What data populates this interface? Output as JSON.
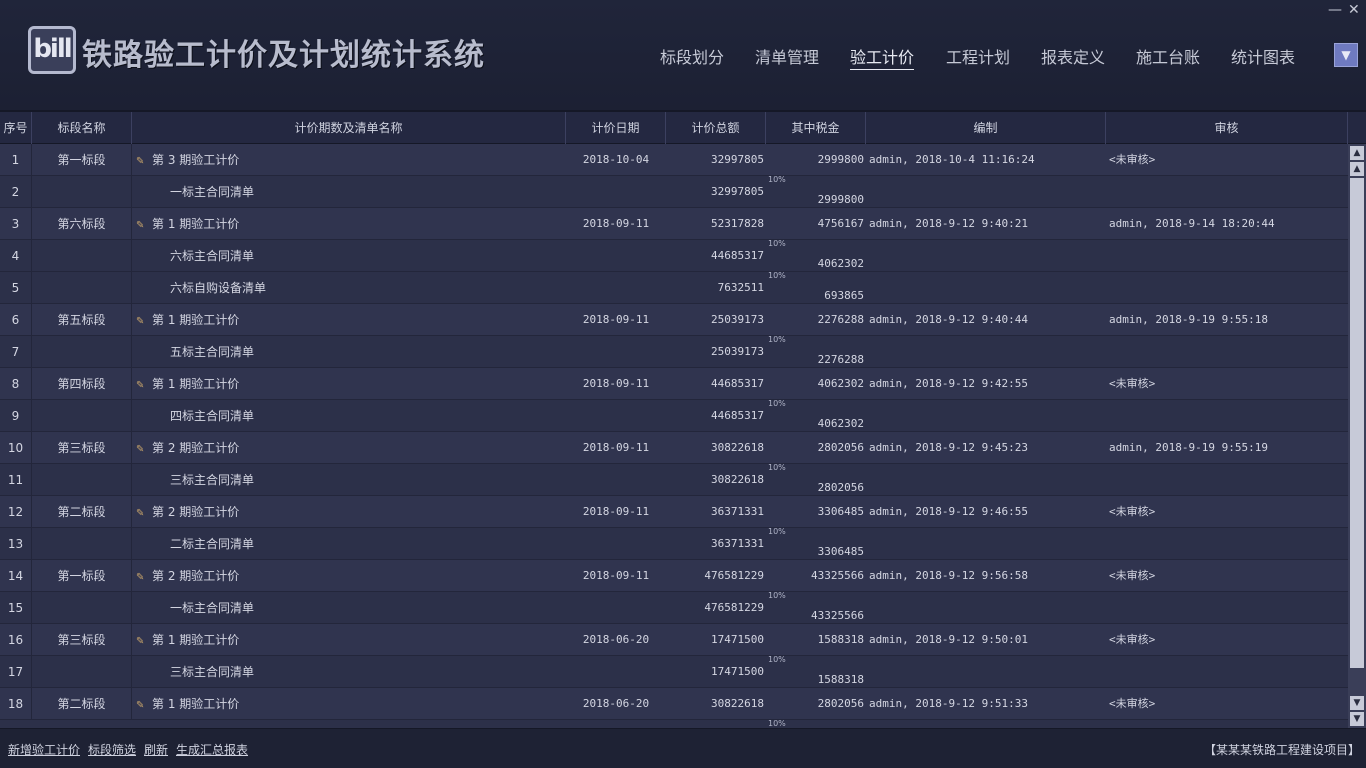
{
  "app": {
    "title": "铁路验工计价及计划统计系统",
    "logo_text": "bill",
    "minimize_label": "—",
    "close_label": "✕"
  },
  "nav": {
    "items": [
      {
        "label": "标段划分"
      },
      {
        "label": "清单管理"
      },
      {
        "label": "验工计价",
        "active": true
      },
      {
        "label": "工程计划"
      },
      {
        "label": "报表定义"
      },
      {
        "label": "施工台账"
      },
      {
        "label": "统计图表"
      }
    ],
    "dropdown_icon": "chevron-down-icon"
  },
  "grid": {
    "headers": [
      "序号",
      "标段名称",
      "计价期数及清单名称",
      "计价日期",
      "计价总额",
      "其中税金",
      "编制",
      "审核"
    ],
    "rows": [
      {
        "seq": "1",
        "section": "第一标段",
        "name": "第 3 期验工计价",
        "date": "2018-10-04",
        "total": "32997805",
        "tax": "2999800",
        "editor": "admin, 2018-10-4 11:16:24",
        "audit": "<未审核>",
        "type": "parent"
      },
      {
        "seq": "2",
        "section": "",
        "name": "一标主合同清单",
        "date": "",
        "total": "32997805",
        "pct": "10%",
        "tax": "2999800",
        "editor": "",
        "audit": "",
        "type": "child"
      },
      {
        "seq": "3",
        "section": "第六标段",
        "name": "第 1 期验工计价",
        "date": "2018-09-11",
        "total": "52317828",
        "tax": "4756167",
        "editor": "admin, 2018-9-12 9:40:21",
        "audit": "admin, 2018-9-14 18:20:44",
        "type": "parent"
      },
      {
        "seq": "4",
        "section": "",
        "name": "六标主合同清单",
        "date": "",
        "total": "44685317",
        "pct": "10%",
        "tax": "4062302",
        "editor": "",
        "audit": "",
        "type": "child"
      },
      {
        "seq": "5",
        "section": "",
        "name": "六标自购设备清单",
        "date": "",
        "total": "7632511",
        "pct": "10%",
        "tax": "693865",
        "editor": "",
        "audit": "",
        "type": "child"
      },
      {
        "seq": "6",
        "section": "第五标段",
        "name": "第 1 期验工计价",
        "date": "2018-09-11",
        "total": "25039173",
        "tax": "2276288",
        "editor": "admin, 2018-9-12 9:40:44",
        "audit": "admin, 2018-9-19 9:55:18",
        "type": "parent"
      },
      {
        "seq": "7",
        "section": "",
        "name": "五标主合同清单",
        "date": "",
        "total": "25039173",
        "pct": "10%",
        "tax": "2276288",
        "editor": "",
        "audit": "",
        "type": "child"
      },
      {
        "seq": "8",
        "section": "第四标段",
        "name": "第 1 期验工计价",
        "date": "2018-09-11",
        "total": "44685317",
        "tax": "4062302",
        "editor": "admin, 2018-9-12 9:42:55",
        "audit": "<未审核>",
        "type": "parent"
      },
      {
        "seq": "9",
        "section": "",
        "name": "四标主合同清单",
        "date": "",
        "total": "44685317",
        "pct": "10%",
        "tax": "4062302",
        "editor": "",
        "audit": "",
        "type": "child"
      },
      {
        "seq": "10",
        "section": "第三标段",
        "name": "第 2 期验工计价",
        "date": "2018-09-11",
        "total": "30822618",
        "tax": "2802056",
        "editor": "admin, 2018-9-12 9:45:23",
        "audit": "admin, 2018-9-19 9:55:19",
        "type": "parent"
      },
      {
        "seq": "11",
        "section": "",
        "name": "三标主合同清单",
        "date": "",
        "total": "30822618",
        "pct": "10%",
        "tax": "2802056",
        "editor": "",
        "audit": "",
        "type": "child"
      },
      {
        "seq": "12",
        "section": "第二标段",
        "name": "第 2 期验工计价",
        "date": "2018-09-11",
        "total": "36371331",
        "tax": "3306485",
        "editor": "admin, 2018-9-12 9:46:55",
        "audit": "<未审核>",
        "type": "parent"
      },
      {
        "seq": "13",
        "section": "",
        "name": "二标主合同清单",
        "date": "",
        "total": "36371331",
        "pct": "10%",
        "tax": "3306485",
        "editor": "",
        "audit": "",
        "type": "child"
      },
      {
        "seq": "14",
        "section": "第一标段",
        "name": "第 2 期验工计价",
        "date": "2018-09-11",
        "total": "476581229",
        "tax": "43325566",
        "editor": "admin, 2018-9-12 9:56:58",
        "audit": "<未审核>",
        "type": "parent"
      },
      {
        "seq": "15",
        "section": "",
        "name": "一标主合同清单",
        "date": "",
        "total": "476581229",
        "pct": "10%",
        "tax": "43325566",
        "editor": "",
        "audit": "",
        "type": "child"
      },
      {
        "seq": "16",
        "section": "第三标段",
        "name": "第 1 期验工计价",
        "date": "2018-06-20",
        "total": "17471500",
        "tax": "1588318",
        "editor": "admin, 2018-9-12 9:50:01",
        "audit": "<未审核>",
        "type": "parent"
      },
      {
        "seq": "17",
        "section": "",
        "name": "三标主合同清单",
        "date": "",
        "total": "17471500",
        "pct": "10%",
        "tax": "1588318",
        "editor": "",
        "audit": "",
        "type": "child"
      },
      {
        "seq": "18",
        "section": "第二标段",
        "name": "第 1 期验工计价",
        "date": "2018-06-20",
        "total": "30822618",
        "tax": "2802056",
        "editor": "admin, 2018-9-12 9:51:33",
        "audit": "<未审核>",
        "type": "parent"
      }
    ],
    "partial_row_pct": "10%",
    "scroll_up_label": "▲",
    "scroll_down_label": "▼"
  },
  "footer": {
    "actions": [
      "新增验工计价",
      "标段筛选",
      "刷新",
      "生成汇总报表"
    ],
    "project": "【某某某铁路工程建设项目】"
  }
}
